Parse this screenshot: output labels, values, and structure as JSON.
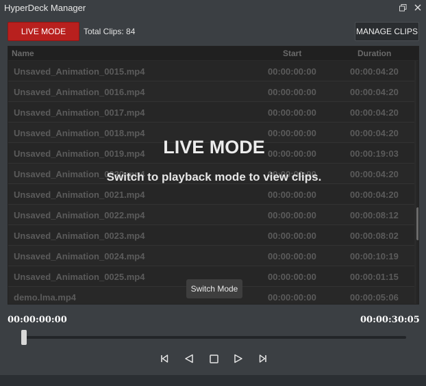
{
  "window": {
    "title": "HyperDeck Manager",
    "restore_icon": "restore-icon",
    "close_icon": "close-icon"
  },
  "toolbar": {
    "live_mode_label": "LIVE MODE",
    "total_clips_label": "Total Clips: 84",
    "manage_clips_label": "MANAGE CLIPS"
  },
  "table": {
    "headers": {
      "name": "Name",
      "start": "Start",
      "duration": "Duration"
    },
    "rows": [
      {
        "name": "Unsaved_Animation_0015.mp4",
        "start": "00:00:00:00",
        "duration": "00:00:04:20"
      },
      {
        "name": "Unsaved_Animation_0016.mp4",
        "start": "00:00:00:00",
        "duration": "00:00:04:20"
      },
      {
        "name": "Unsaved_Animation_0017.mp4",
        "start": "00:00:00:00",
        "duration": "00:00:04:20"
      },
      {
        "name": "Unsaved_Animation_0018.mp4",
        "start": "00:00:00:00",
        "duration": "00:00:04:20"
      },
      {
        "name": "Unsaved_Animation_0019.mp4",
        "start": "00:00:00:00",
        "duration": "00:00:19:03"
      },
      {
        "name": "Unsaved_Animation_0020.mp4",
        "start": "00:00:00:00",
        "duration": "00:00:04:20"
      },
      {
        "name": "Unsaved_Animation_0021.mp4",
        "start": "00:00:00:00",
        "duration": "00:00:04:20"
      },
      {
        "name": "Unsaved_Animation_0022.mp4",
        "start": "00:00:00:00",
        "duration": "00:00:08:12"
      },
      {
        "name": "Unsaved_Animation_0023.mp4",
        "start": "00:00:00:00",
        "duration": "00:00:08:02"
      },
      {
        "name": "Unsaved_Animation_0024.mp4",
        "start": "00:00:00:00",
        "duration": "00:00:10:19"
      },
      {
        "name": "Unsaved_Animation_0025.mp4",
        "start": "00:00:00:00",
        "duration": "00:00:01:15"
      },
      {
        "name": "demo.lma.mp4",
        "start": "00:00:00:00",
        "duration": "00:00:05:06"
      }
    ]
  },
  "overlay": {
    "title": "LIVE MODE",
    "subtitle": "Switch to playback mode to view clips.",
    "switch_button_label": "Switch Mode"
  },
  "transport": {
    "current_timecode": "00:00:00:00",
    "total_timecode": "00:00:30:05",
    "position": 0,
    "controls": [
      "skip-previous-icon",
      "play-reverse-icon",
      "stop-icon",
      "play-icon",
      "skip-next-icon"
    ]
  },
  "colors": {
    "live_mode_red": "#b8201e",
    "background": "#3b3f43"
  }
}
